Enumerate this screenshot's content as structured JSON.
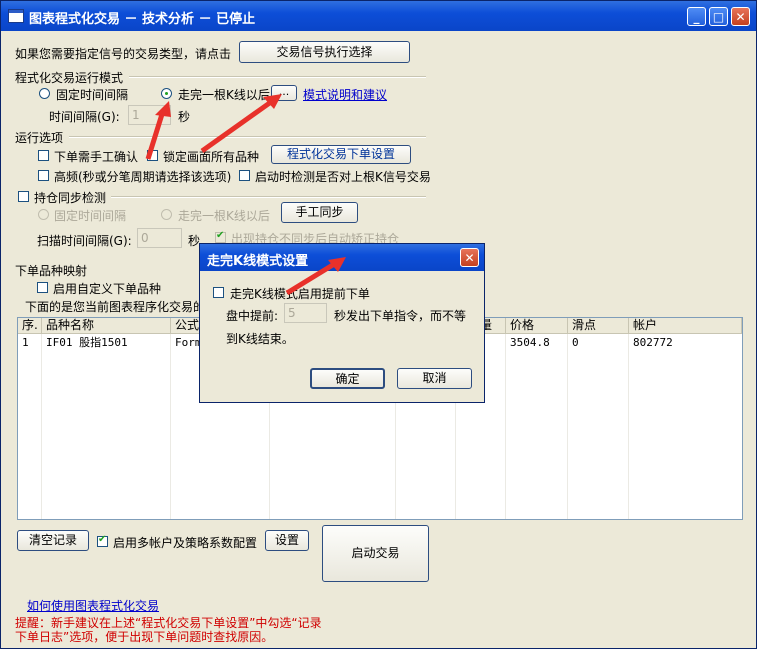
{
  "window": {
    "title": "图表程式化交易 － 技术分析 － 已停止"
  },
  "top": {
    "prompt": "如果您需要指定信号的交易类型，请点击",
    "signal_button": "交易信号执行选择"
  },
  "run_mode": {
    "header": "程式化交易运行模式",
    "fixed_interval": "固定时间间隔",
    "after_bar": "走完一根K线以后",
    "dots_button": "...",
    "mode_link": "模式说明和建议",
    "interval_label": "时间间隔(G):",
    "interval_value": "1",
    "sec": "秒"
  },
  "options": {
    "header": "运行选项",
    "manual_confirm": "下单需手工确认",
    "lock_all": "锁定画面所有品种",
    "order_settings_button": "程式化交易下单设置",
    "high_freq": "高频(秒或分笔周期请选择该选项)",
    "check_on_start": "启动时检测是否对上根K信号交易"
  },
  "sync": {
    "header": "持仓同步检测",
    "fixed_interval": "固定时间间隔",
    "after_bar": "走完一根K线以后",
    "manual_sync_button": "手工同步",
    "scan_label": "扫描时间间隔(G):",
    "scan_value": "0",
    "sec": "秒",
    "auto_fix": "出现持仓不同步后自动矫正持仓"
  },
  "mapping": {
    "header": "下单品种映射",
    "custom_enable": "启用自定义下单品种",
    "desc": "下面的是您当前图表程序化交易的"
  },
  "table": {
    "columns": [
      "序.",
      "品种名称",
      "公式",
      "量",
      "价格",
      "滑点",
      "帐户"
    ],
    "rows": [
      {
        "seq": "1",
        "name": "IF01 股指1501",
        "formula": "Form",
        "qty": "",
        "price": "3504.8",
        "slip": "0",
        "account": "802772"
      }
    ]
  },
  "bottom": {
    "clear_button": "清空记录",
    "multi_account": "启用多帐户及策略系数配置",
    "settings_button": "设置",
    "start_button": "启动交易",
    "howto_link": "如何使用图表程式化交易",
    "tip_line1": "提醒：新手建议在上述“程式化交易下单设置”中勾选“记录",
    "tip_line2": "下单日志”选项，便于出现下单问题时查找原因。"
  },
  "dialog": {
    "title": "走完K线模式设置",
    "enable_early": "走完K线模式启用提前下单",
    "early_label": "盘中提前:",
    "early_value": "5",
    "early_suffix": "秒发出下单指令，而不等",
    "early_suffix2": "到K线结束。",
    "ok": "确定",
    "cancel": "取消"
  },
  "colors": {
    "arrow": "#e8312a",
    "titlebar": "#0d4ed8",
    "tip": "#d00000"
  }
}
